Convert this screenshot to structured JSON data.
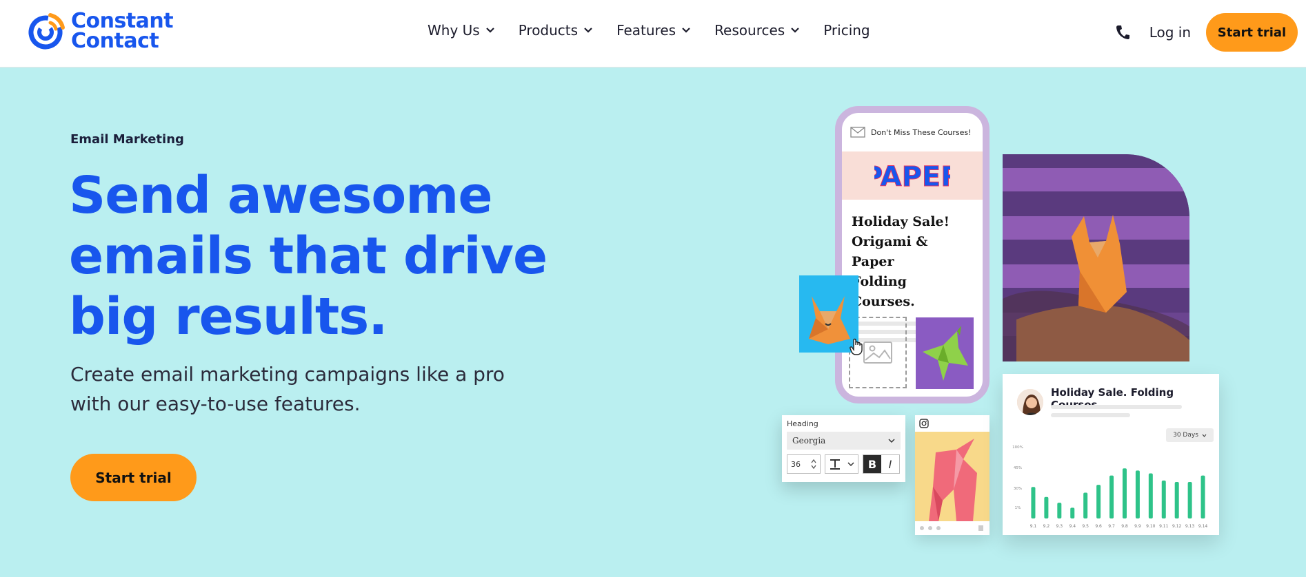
{
  "brand": {
    "line1": "Constant",
    "line2": "Contact",
    "color": "#1856ed"
  },
  "nav": {
    "items": [
      {
        "label": "Why Us",
        "has_dropdown": true
      },
      {
        "label": "Products",
        "has_dropdown": true
      },
      {
        "label": "Features",
        "has_dropdown": true
      },
      {
        "label": "Resources",
        "has_dropdown": true
      },
      {
        "label": "Pricing",
        "has_dropdown": false
      }
    ],
    "phone_icon": "phone-icon",
    "login_label": "Log in",
    "cta_label": "Start trial"
  },
  "hero": {
    "eyebrow": "Email Marketing",
    "headline_lines": [
      "Send awesome",
      "emails that drive",
      "big results."
    ],
    "subhead_lines": [
      "Create email marketing campaigns like a pro",
      "with our easy-to-use features."
    ],
    "cta_label": "Start trial",
    "background": "#baeff0",
    "accent": "#ff9a1a"
  },
  "phone_mockup": {
    "subject": "Don't Miss These Courses!",
    "brand_word": "PAPER",
    "title_lines": [
      "Holiday Sale!",
      "Origami & Paper",
      "Folding Courses."
    ]
  },
  "editor_card": {
    "label": "Heading",
    "font": "Georgia",
    "size": "36",
    "bold": "B",
    "italic": "I"
  },
  "analytics_card": {
    "title": "Holiday Sale. Folding Courses",
    "range": "30 Days",
    "chart_data": {
      "type": "bar",
      "y_ticks": [
        "100%",
        "45%",
        "30%",
        "1%"
      ],
      "categories": [
        "9.1",
        "9.2",
        "9.3",
        "9.4",
        "9.5",
        "9.6",
        "9.7",
        "9.8",
        "9.9",
        "9.10",
        "9.11",
        "9.12",
        "9.13",
        "9.14"
      ],
      "values": [
        44,
        30,
        22,
        15,
        36,
        47,
        60,
        70,
        67,
        63,
        53,
        51,
        51,
        60
      ],
      "ylim": [
        0,
        100
      ],
      "color": "#2ec389"
    }
  }
}
